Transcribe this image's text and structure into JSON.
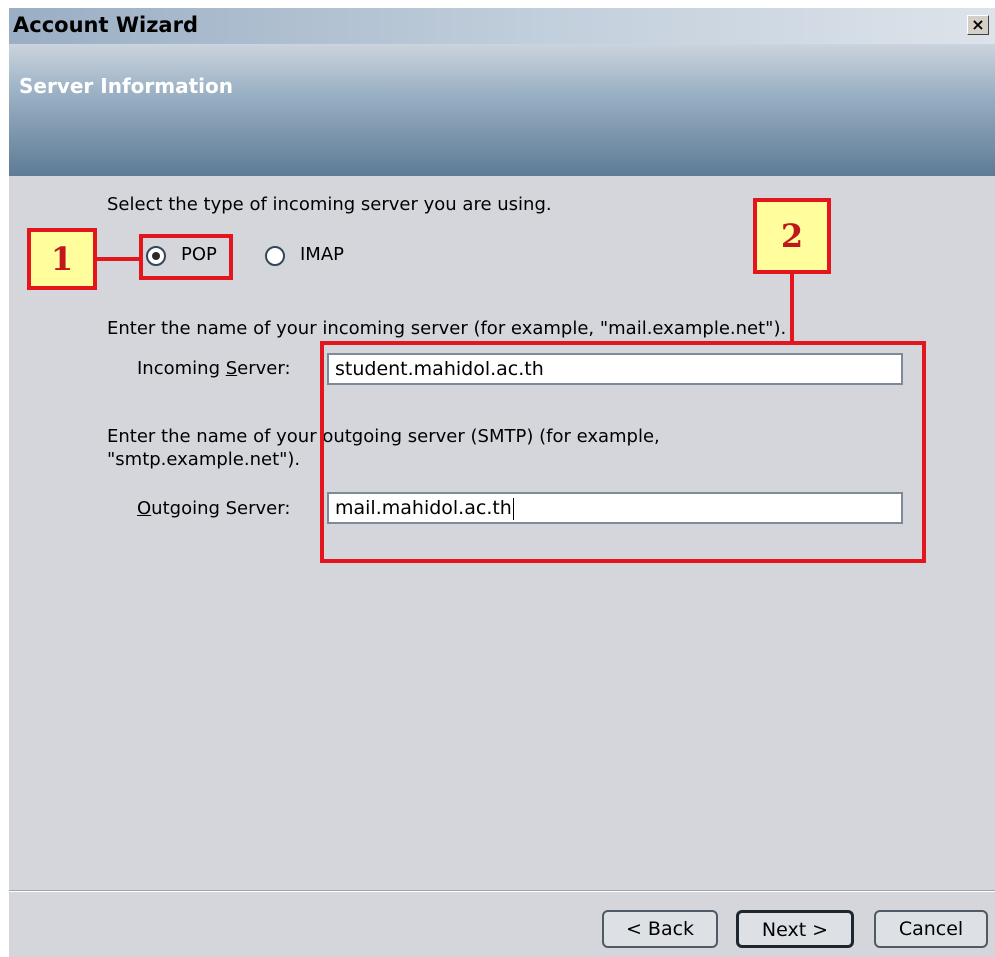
{
  "window": {
    "title": "Account Wizard",
    "close_glyph": "×"
  },
  "header": {
    "title": "Server Information"
  },
  "server_type": {
    "prompt": "Select the type of incoming server you are using.",
    "options": [
      {
        "label": "POP",
        "selected": true
      },
      {
        "label": "IMAP",
        "selected": false
      }
    ]
  },
  "incoming": {
    "instruction": "Enter the name of your incoming server (for example, \"mail.example.net\").",
    "label_prefix": "Incoming ",
    "label_accesskey": "S",
    "label_suffix": "erver:",
    "value": "student.mahidol.ac.th"
  },
  "outgoing": {
    "instruction_line1": "Enter the name of your outgoing server (SMTP) (for example,",
    "instruction_line2": "\"smtp.example.net\").",
    "label_accesskey": "O",
    "label_suffix": "utgoing Server:",
    "value": "mail.mahidol.ac.th"
  },
  "annotations": {
    "badge_1": "1",
    "badge_2": "2",
    "color": "#e4161d"
  },
  "buttons": {
    "back": "< Back",
    "next": "Next >",
    "cancel": "Cancel"
  }
}
